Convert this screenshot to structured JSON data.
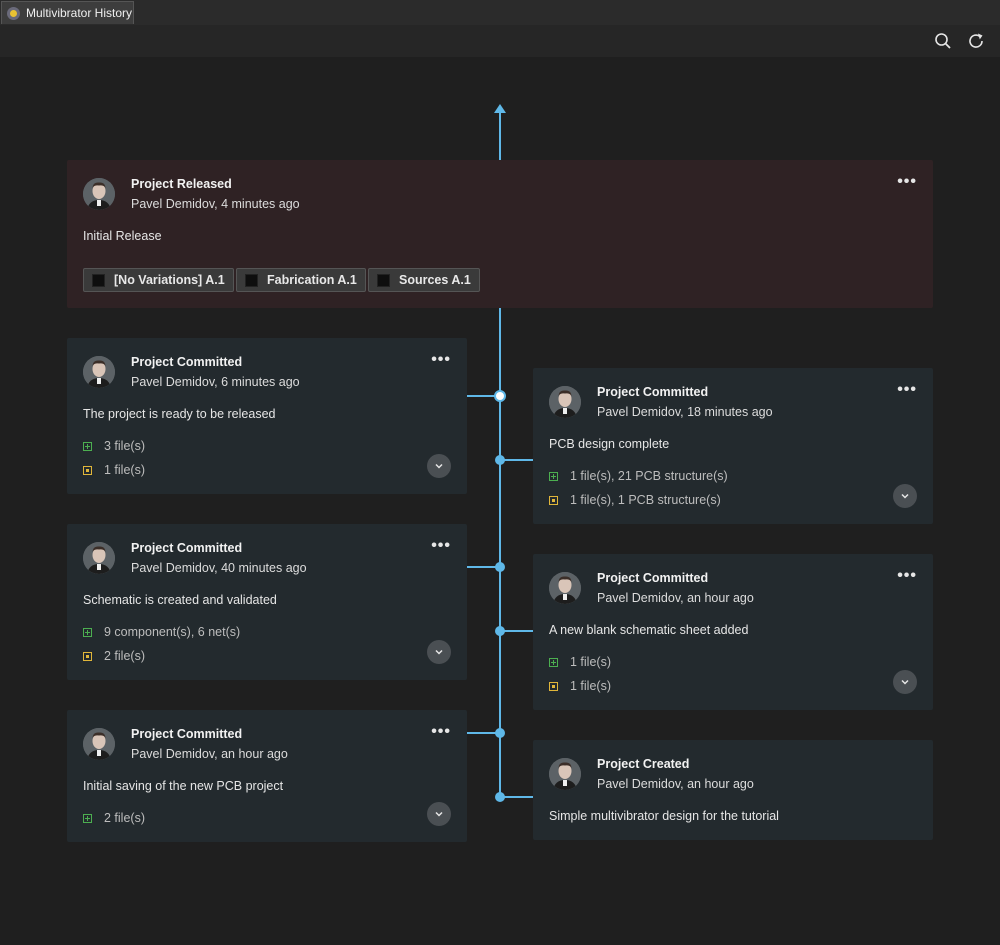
{
  "window": {
    "tab_title": "Multivibrator History"
  },
  "toolbar": {
    "search_icon": "search-icon",
    "refresh_icon": "refresh-icon"
  },
  "timeline": {
    "released": {
      "title": "Project Released",
      "author": "Pavel Demidov, 4 minutes ago",
      "message": "Initial Release",
      "tags": [
        "[No Variations] A.1",
        "Fabrication A.1",
        "Sources A.1"
      ]
    },
    "commits": [
      {
        "title": "Project Committed",
        "author": "Pavel Demidov, 6 minutes ago",
        "message": "The project is ready to be released",
        "added": "3 file(s)",
        "modified": "1 file(s)"
      },
      {
        "title": "Project Committed",
        "author": "Pavel Demidov, 18 minutes ago",
        "message": "PCB design complete",
        "added": "1 file(s), 21 PCB structure(s)",
        "modified": "1 file(s), 1 PCB structure(s)"
      },
      {
        "title": "Project Committed",
        "author": "Pavel Demidov, 40 minutes ago",
        "message": "Schematic is created and validated",
        "added": "9 component(s), 6 net(s)",
        "modified": "2 file(s)"
      },
      {
        "title": "Project Committed",
        "author": "Pavel Demidov, an hour ago",
        "message": "A new blank schematic sheet added",
        "added": "1 file(s)",
        "modified": "1 file(s)"
      },
      {
        "title": "Project Committed",
        "author": "Pavel Demidov, an hour ago",
        "message": "Initial saving of the new PCB project",
        "added": "2 file(s)"
      },
      {
        "title": "Project Created",
        "author": "Pavel Demidov, an hour ago",
        "message": "Simple multivibrator design for the tutorial"
      }
    ]
  },
  "colors": {
    "accent": "#5fb8e8",
    "released_bg": "#2f2224",
    "card_bg": "#232a2e",
    "added": "#4caf50",
    "modified": "#e0b63a"
  }
}
